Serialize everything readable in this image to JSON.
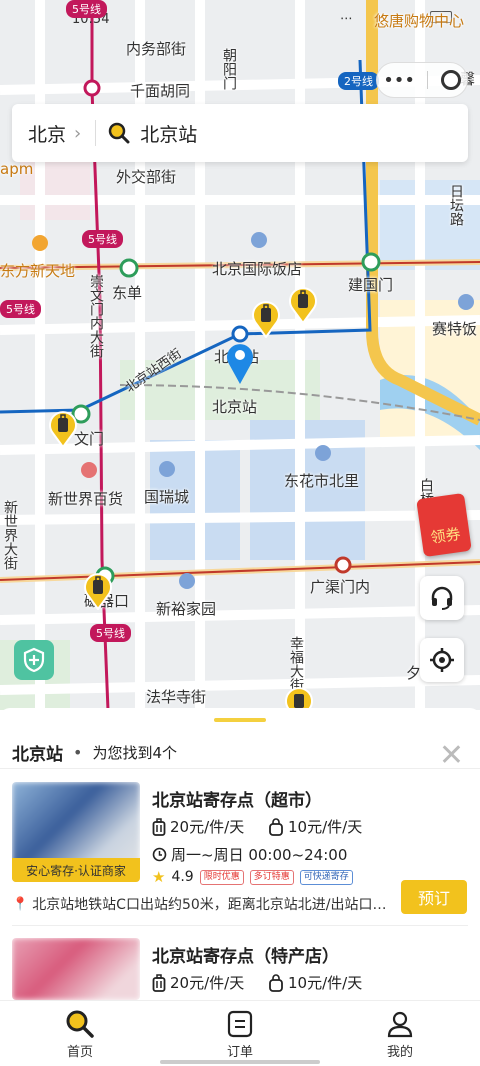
{
  "status_bar": {
    "time": "10:54"
  },
  "search": {
    "city": "北京",
    "query": "北京站"
  },
  "map": {
    "labels": [
      {
        "text": "悠唐购物中心",
        "style": "orange"
      },
      {
        "text": "内务部街"
      },
      {
        "text": "朝阳门"
      },
      {
        "text": "千面胡同"
      },
      {
        "text": "馨"
      },
      {
        "text": "外交部街"
      },
      {
        "text": "日坛路"
      },
      {
        "text": "apm",
        "style": "orange"
      },
      {
        "text": "东方新天地",
        "style": "orange"
      },
      {
        "text": "北京国际饭店"
      },
      {
        "text": "建国门"
      },
      {
        "text": "东单"
      },
      {
        "text": "崇文门内大街"
      },
      {
        "text": "赛特饭"
      },
      {
        "text": "北京站"
      },
      {
        "text": "北京站"
      },
      {
        "text": "北京站西街"
      },
      {
        "text": "文门"
      },
      {
        "text": "国瑞城"
      },
      {
        "text": "东花市北里"
      },
      {
        "text": "新世界百货"
      },
      {
        "text": "白桥"
      },
      {
        "text": "新世界大街"
      },
      {
        "text": "广渠门内"
      },
      {
        "text": "新裕家园"
      },
      {
        "text": "磁器口"
      },
      {
        "text": "幸福大街"
      },
      {
        "text": "法华寺街"
      },
      {
        "text": "夕"
      }
    ],
    "line_badges": [
      {
        "text": "5号线",
        "color": "#c2185b"
      },
      {
        "text": "2号线",
        "color": "#1565c0"
      },
      {
        "text": "5号线",
        "color": "#c2185b"
      },
      {
        "text": "5号线",
        "color": "#c2185b"
      },
      {
        "text": "5号线",
        "color": "#c2185b"
      }
    ],
    "coupon": "领券"
  },
  "results": {
    "location": "北京站",
    "count_text": "为您找到4个",
    "items": [
      {
        "name": "北京站寄存点（超市）",
        "price_large": "20元/件/天",
        "price_small": "10元/件/天",
        "hours": "周一~周日 00:00~24:00",
        "rating": "4.9",
        "badges": [
          "限时优惠",
          "多订特惠",
          "可快递寄存"
        ],
        "tag": "安心寄存·认证商家",
        "address": "北京站地铁站C口出站约50米，距离北京站北进/出站口…",
        "button": "预订"
      },
      {
        "name": "北京站寄存点（特产店）",
        "price_large": "20元/件/天",
        "price_small": "10元/件/天"
      }
    ]
  },
  "tabs": [
    {
      "label": "首页",
      "icon": "search-icon"
    },
    {
      "label": "订单",
      "icon": "order-icon"
    },
    {
      "label": "我的",
      "icon": "user-icon"
    }
  ],
  "colors": {
    "accent": "#f2c21d",
    "line5": "#c2185b",
    "line2": "#1565c0"
  }
}
